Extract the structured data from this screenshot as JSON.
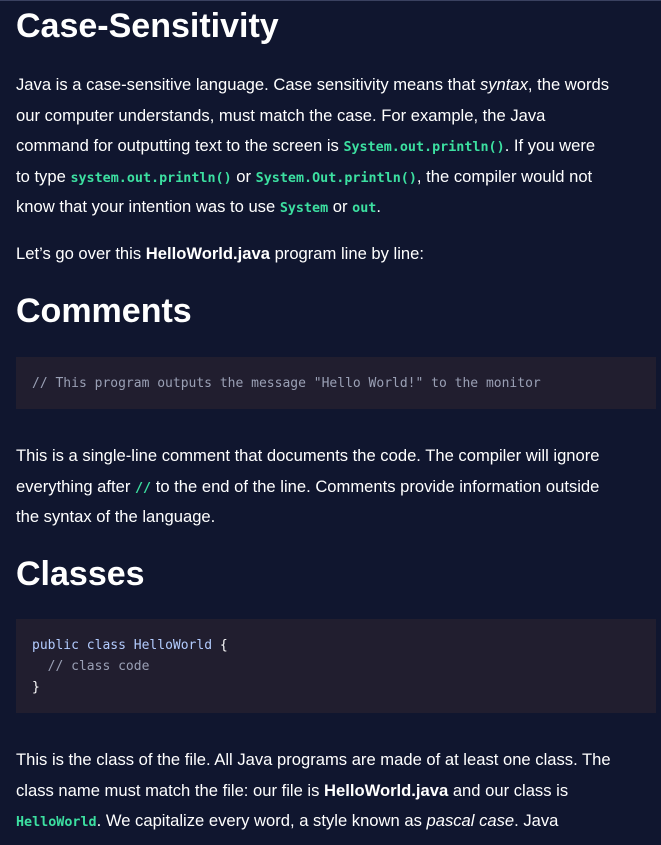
{
  "sections": {
    "case": {
      "heading": "Case-Sensitivity",
      "para1": {
        "l1a": "Java is a case-sensitive language. Case sensitivity means that ",
        "l1b": "syntax",
        "l1c": ", the words",
        "l2": "our computer understands, must match the case. For example, the Java",
        "l3a": "command for outputting text to the screen is ",
        "l3code": "System.out.println()",
        "l3b": ". If you were",
        "l4a": "to type ",
        "l4code1": "system.out.println()",
        "l4b": " or ",
        "l4code2": "System.Out.println()",
        "l4c": ", the compiler would not",
        "l5a": "know that your intention was to use ",
        "l5code1": "System",
        "l5b": " or ",
        "l5code2": "out",
        "l5c": "."
      },
      "para2": {
        "a": "Let’s go over this ",
        "b": "HelloWorld.java",
        "c": " program line by line:"
      }
    },
    "comments": {
      "heading": "Comments",
      "code": "// This program outputs the message \"Hello World!\" to the monitor",
      "para": {
        "l1": "This is a single-line comment that documents the code. The compiler will ignore",
        "l2a": "everything after ",
        "l2code": "//",
        "l2b": " to the end of the line. Comments provide information outside",
        "l3": "the syntax of the language."
      }
    },
    "classes": {
      "heading": "Classes",
      "code": {
        "line1_kw1": "public",
        "line1_kw2": "class",
        "line1_id": "HelloWorld",
        "line1_brace": "{",
        "line2": "  // class code",
        "line3": "}"
      },
      "para": {
        "l1": "This is the class of the file. All Java programs are made of at least one class. The",
        "l2a": "class name must match the file: our file is ",
        "l2b": "HelloWorld.java",
        "l2c": " and our class is",
        "l3code": "HelloWorld",
        "l3a": ". We capitalize every word, a style known as ",
        "l3b": "pascal case",
        "l3c": ". Java"
      }
    }
  },
  "colors": {
    "background": "#10162f",
    "code_background": "#211e2f",
    "inline_code": "#3ce0a1",
    "comment": "#9aa0b5",
    "keyword": "#b3ccff"
  }
}
